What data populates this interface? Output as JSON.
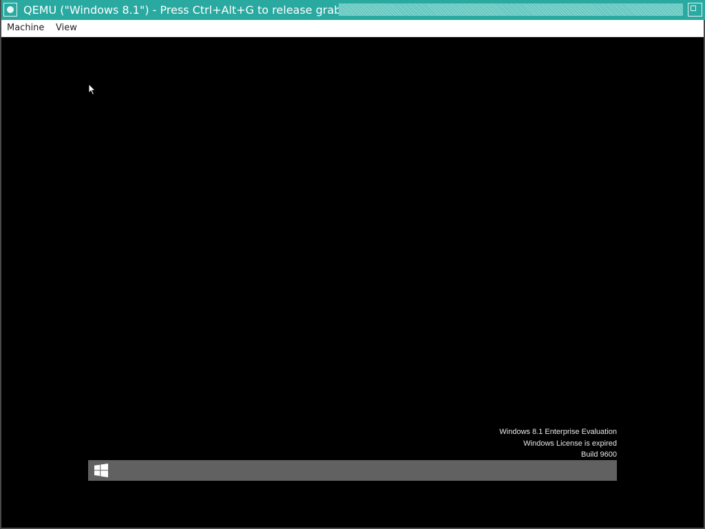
{
  "window": {
    "title": "QEMU (\"Windows 8.1\") - Press Ctrl+Alt+G to release grab",
    "accent_color": "#2aa9a0",
    "icons": {
      "menu": "window-menu-icon",
      "maximize": "maximize-icon"
    }
  },
  "menubar": {
    "items": [
      {
        "label": "Machine"
      },
      {
        "label": "View"
      }
    ]
  },
  "guest": {
    "watermark": {
      "edition": "Windows 8.1 Enterprise Evaluation",
      "license": "Windows License is expired",
      "build": "Build 9600"
    },
    "taskbar": {
      "color": "#616161",
      "start_icon": "windows-logo-icon"
    },
    "cursor_icon": "mouse-pointer-icon"
  }
}
